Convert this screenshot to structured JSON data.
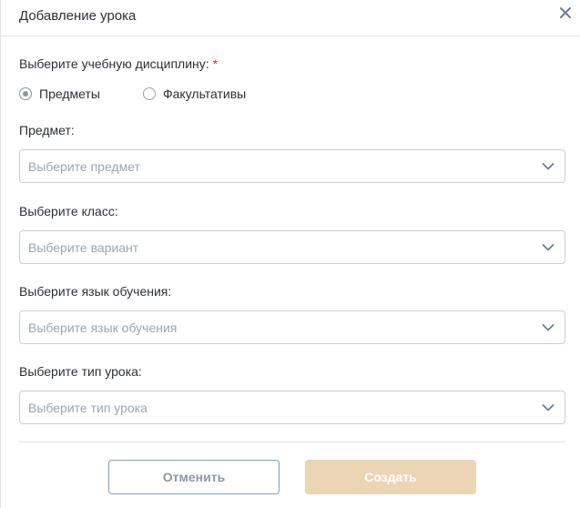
{
  "dialog": {
    "title": "Добавление урока",
    "close_icon": "close-icon"
  },
  "discipline": {
    "label": "Выберите учебную дисциплину:",
    "required_mark": "*",
    "options": [
      {
        "label": "Предметы",
        "checked": true
      },
      {
        "label": "Факультативы",
        "checked": false
      }
    ]
  },
  "fields": {
    "subject": {
      "label": "Предмет:",
      "placeholder": "Выберите предмет"
    },
    "class": {
      "label": "Выберите класс:",
      "placeholder": "Выберите вариант"
    },
    "language": {
      "label": "Выберите язык обучения:",
      "placeholder": "Выберите язык обучения"
    },
    "lesson_type": {
      "label": "Выберите тип урока:",
      "placeholder": "Выберите тип урока"
    }
  },
  "actions": {
    "cancel_label": "Отменить",
    "create_label": "Создать"
  },
  "colors": {
    "required": "#e0283b",
    "cancel_border": "#7e9fc0",
    "create_bg": "#ecd5b4",
    "placeholder": "#9ca6b1"
  }
}
